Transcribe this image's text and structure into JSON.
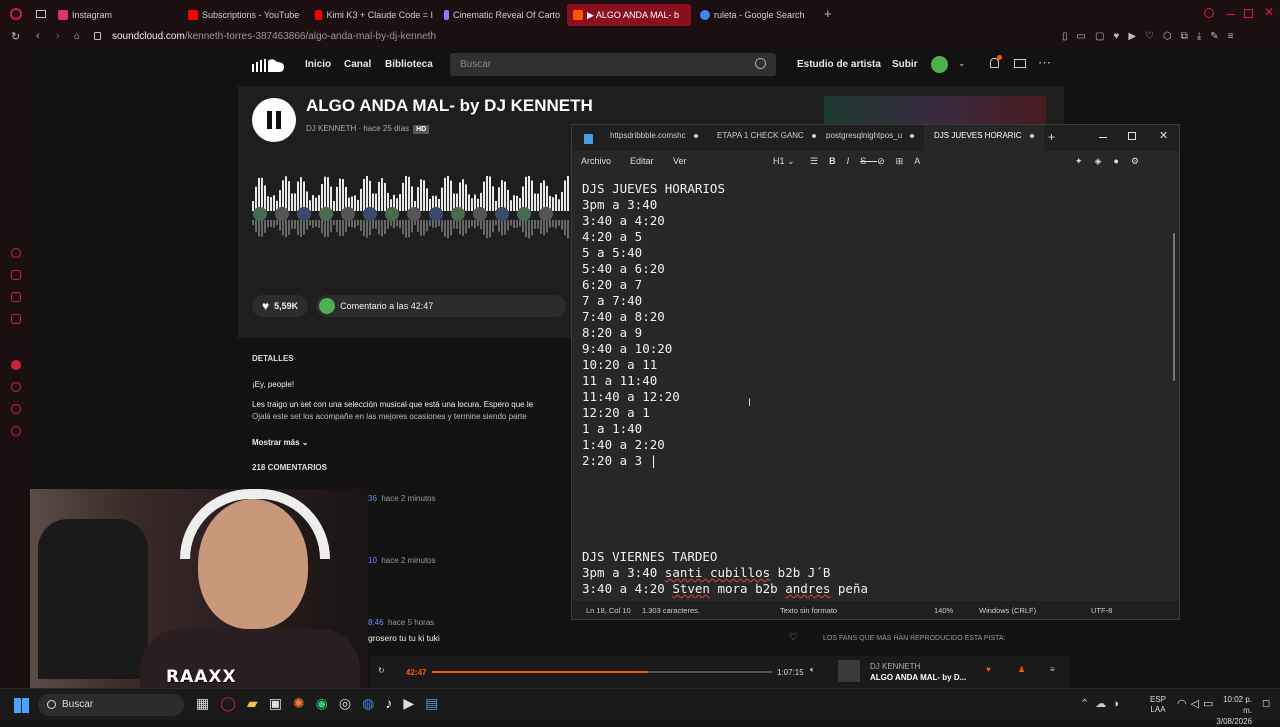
{
  "browser": {
    "tabs": [
      {
        "label": "Instagram",
        "color": "#e1306c"
      },
      {
        "label": "Subscriptions - YouTube",
        "color": "#ff0000"
      },
      {
        "label": "Kimi K3 + Claude Code = I",
        "color": "#ff0000"
      },
      {
        "label": "Cinematic Reveal Of Carto",
        "color": "#8a7cff"
      },
      {
        "label": "▶ ALGO ANDA MAL- b",
        "color": "#ff5500"
      },
      {
        "label": "ruleta - Google Search",
        "color": "#4285f4"
      }
    ],
    "url_host": "soundcloud.com",
    "url_path": "/kenneth-torres-387463866/algo-anda-mal-by-dj-kenneth"
  },
  "soundcloud": {
    "nav": {
      "home": "Inicio",
      "feed": "Canal",
      "library": "Biblioteca",
      "search_placeholder": "Buscar",
      "artist_studio": "Estudio de artista",
      "upload": "Subir"
    },
    "track": {
      "title": "ALGO ANDA MAL- by DJ KENNETH",
      "artist": "DJ KENNETH",
      "age": "hace 25 días",
      "quality": "HD",
      "likes": "5,59K",
      "comment_prompt": "Comentario a las 42:47"
    },
    "details": {
      "heading": "DETALLES",
      "greeting": "¡Ey, people!",
      "line1": "Les traigo un set con una selección musical que está una locura. Espero que le",
      "line2": "Ojalá este set los acompañe en las mejores ocasiones y termine siendo parte",
      "show_more": "Mostrar más",
      "comments_count": "218 COMENTARIOS"
    },
    "comments": [
      {
        "time": "hace 2 minutos",
        "badge": "36"
      },
      {
        "time": "hace 2 minutos",
        "badge": "10"
      },
      {
        "time": "hace 5 horas",
        "badge": "8:46",
        "text": "grosero tu tu ki tuki"
      }
    ],
    "sidebar_label": "LOS FANS QUE MÁS HAN REPRODUCIDO ESTA PISTA:",
    "player": {
      "elapsed": "42:47",
      "duration": "1:07:15",
      "progress": 0.636,
      "artist": "DJ KENNETH",
      "title": "ALGO ANDA MAL- by D..."
    }
  },
  "notepad": {
    "tabs": [
      {
        "label": "httpsdribbble.comshc"
      },
      {
        "label": "ETAPA 1 CHECK GANC"
      },
      {
        "label": "postgresqlnightpos_u"
      },
      {
        "label": "DJS JUEVES HORARIC"
      }
    ],
    "menu": {
      "file": "Archivo",
      "edit": "Editar",
      "view": "Ver",
      "heading": "H1"
    },
    "lines": [
      "DJS JUEVES HORARIOS",
      "3pm a 3:40",
      "3:40 a 4:20",
      "4:20 a 5",
      "5 a 5:40",
      "5:40 a 6:20",
      "6:20 a 7",
      "7 a 7:40",
      "7:40 a 8:20",
      "8:20 a 9",
      "9:40 a 10:20",
      "10:20 a 11",
      "11 a 11:40",
      "11:40 a 12:20",
      "12:20 a 1",
      "1 a 1:40",
      "1:40 a 2:20",
      "2:20 a 3"
    ],
    "lines2_heading": "DJS VIERNES TARDEO",
    "lines2_a": "3pm a 3:40 ",
    "lines2_a_name": "santi cubillos",
    "lines2_a_rest": " b2b J´B",
    "lines2_b": "3:40 a 4:20 ",
    "lines2_b_name1": "Stven",
    "lines2_b_mid": " mora b2b ",
    "lines2_b_name2": "andres",
    "lines2_b_rest": " peña",
    "status": {
      "position": "Ln 18, Col 10",
      "chars": "1.303 caracteres.",
      "format": "Texto sin formato",
      "zoom": "140%",
      "eol": "Windows (CRLF)",
      "encoding": "UTF-8"
    }
  },
  "taskbar": {
    "search": "Buscar",
    "lang1": "ESP",
    "lang2": "LAA",
    "time": "10:02 p. m.",
    "date": "3/08/2026"
  },
  "webcam_overlay": "RAAXX"
}
